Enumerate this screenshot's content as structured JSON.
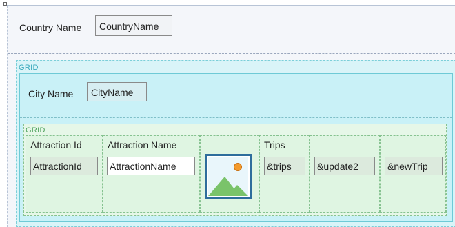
{
  "country": {
    "label": "Country Name",
    "field": "CountryName"
  },
  "outer_grid": {
    "tag": "GRID"
  },
  "city": {
    "label": "City Name",
    "field": "CityName"
  },
  "inner_grid": {
    "tag": "GRID",
    "columns": [
      {
        "title": "Attraction Id",
        "field": "AttractionId"
      },
      {
        "title": "Attraction Name",
        "field": "AttractionName"
      },
      {
        "title": "",
        "field": "",
        "icon": "image-placeholder-icon"
      },
      {
        "title": "Trips",
        "field": "&trips"
      },
      {
        "title": "",
        "field": "&update2"
      },
      {
        "title": "",
        "field": "&newTrip"
      }
    ]
  },
  "colors": {
    "outer_grid_bg": "#d9f4f8",
    "outer_grid_tag": "#35a7ba",
    "inner_grid_bg": "#e6f7e8",
    "inner_grid_tag": "#4ca05a",
    "image_frame": "#2e6d9c"
  }
}
